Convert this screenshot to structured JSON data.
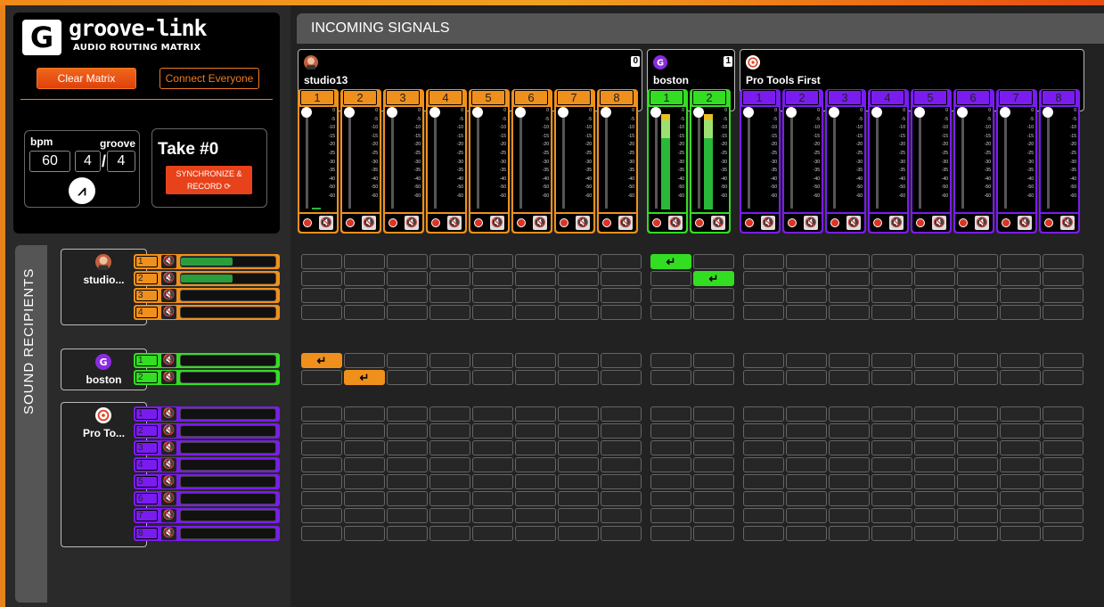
{
  "app": {
    "logo_letter": "G",
    "title": "groove-link",
    "subtitle": "AUDIO ROUTING MATRIX"
  },
  "controls": {
    "clear_label": "Clear Matrix",
    "connect_label": "Connect Everyone",
    "bpm_label": "bpm",
    "groove_label": "groove",
    "bpm_value": "60",
    "meter_top": "4",
    "meter_bottom": "4",
    "slash": "/",
    "take_label": "Take #0",
    "sync_label_1": "SYNCHRONIZE &",
    "sync_label_2": "RECORD ⟳"
  },
  "incoming_title": "INCOMING SIGNALS",
  "recipients_title": "SOUND RECIPIENTS",
  "colors": {
    "orange": "#f0901c",
    "green": "#33dd22",
    "purple": "#7a1cf0"
  },
  "scale": [
    "0",
    "-5",
    "-10",
    "-15",
    "-20",
    "-25",
    "-30",
    "-35",
    "-40",
    "",
    "",
    "-50",
    "-60"
  ],
  "sources": [
    {
      "name": "studio13",
      "count": "0",
      "color": "#f0901c",
      "channels": [
        "1",
        "2",
        "3",
        "4",
        "5",
        "6",
        "7",
        "8"
      ],
      "levels": [
        0.02,
        0,
        0,
        0,
        0,
        0,
        0,
        0
      ]
    },
    {
      "name": "boston",
      "count": "1",
      "color": "#33dd22",
      "channels": [
        "1",
        "2"
      ],
      "levels": [
        0.95,
        0.95
      ]
    },
    {
      "name": "Pro Tools First",
      "count": "",
      "color": "#7a1cf0",
      "channels": [
        "1",
        "2",
        "3",
        "4",
        "5",
        "6",
        "7",
        "8"
      ],
      "levels": [
        0,
        0,
        0,
        0,
        0,
        0,
        0,
        0
      ]
    }
  ],
  "recipients": [
    {
      "name": "studio...",
      "color": "#f0901c",
      "channels": [
        "1",
        "2",
        "3",
        "4"
      ],
      "levels": [
        0.55,
        0.55,
        0,
        0
      ]
    },
    {
      "name": "boston",
      "color": "#33dd22",
      "channels": [
        "1",
        "2"
      ],
      "levels": [
        0,
        0
      ]
    },
    {
      "name": "Pro To...",
      "color": "#7a1cf0",
      "channels": [
        "1",
        "2",
        "3",
        "4",
        "5",
        "6",
        "7",
        "8"
      ],
      "levels": [
        0,
        0,
        0,
        0,
        0,
        0,
        0,
        0
      ]
    }
  ],
  "routes": [
    {
      "recipient": 0,
      "row": 0,
      "source": 1,
      "col": 0
    },
    {
      "recipient": 0,
      "row": 1,
      "source": 1,
      "col": 1
    },
    {
      "recipient": 1,
      "row": 0,
      "source": 0,
      "col": 0
    },
    {
      "recipient": 1,
      "row": 1,
      "source": 0,
      "col": 1
    }
  ],
  "route_glyph": "↵",
  "mute_glyph": "🔇"
}
